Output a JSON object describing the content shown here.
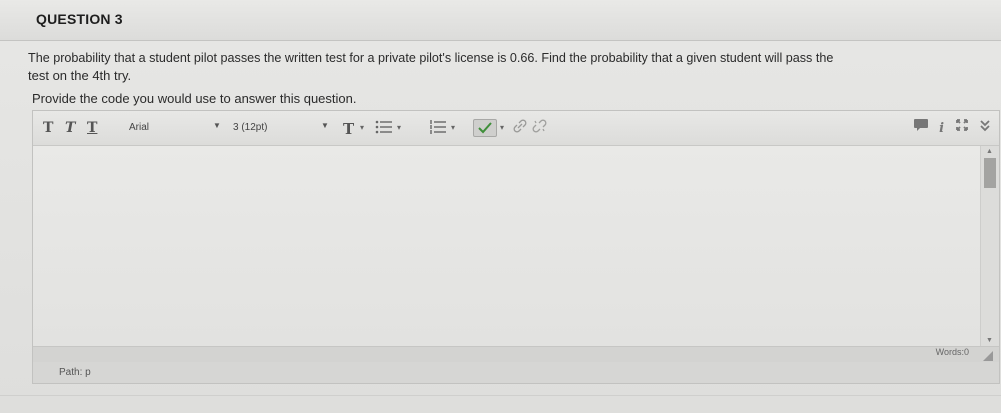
{
  "question": {
    "title": "QUESTION 3",
    "text_line1": "The probability that a student pilot passes the written test for a private pilot's license is 0.66.  Find the probability that a given student will pass the",
    "text_line2": "test on the 4th try.",
    "prompt": "Provide the code you would use to answer this question."
  },
  "toolbar": {
    "format_t1": "T",
    "format_t2": "T",
    "format_t3": "T",
    "font_family": "Arial",
    "font_size": "3 (12pt)",
    "text_color": "T"
  },
  "editor": {
    "words": "Words:0",
    "path": "Path: p"
  }
}
